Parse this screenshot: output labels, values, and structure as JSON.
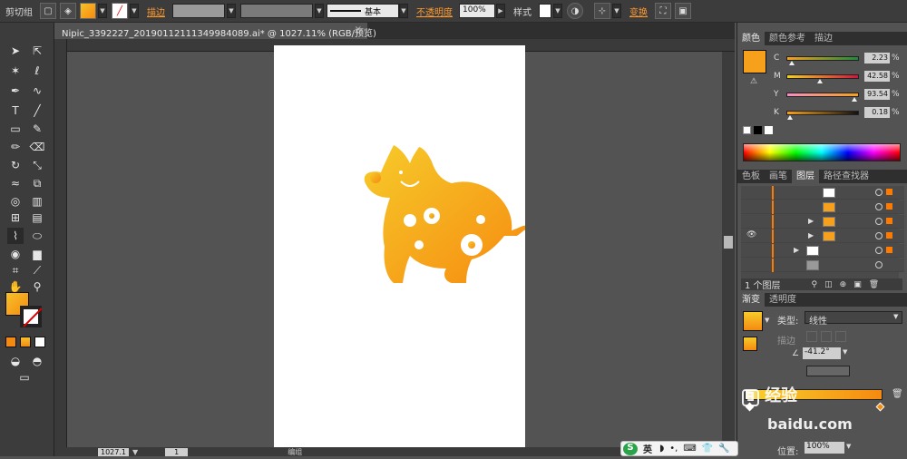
{
  "control_bar": {
    "selection_label": "剪切组",
    "stroke_label": "描边",
    "stroke_style_label": "基本",
    "opacity_label": "不透明度",
    "opacity_value": "100%",
    "style_label": "样式",
    "transform_label": "变换"
  },
  "document_tab": {
    "title": "Nipic_3392227_20190112111349984089.ai* @ 1027.11% (RGB/预览)",
    "close_glyph": "×"
  },
  "color_panel": {
    "tabs": [
      "颜色",
      "颜色参考",
      "描边"
    ],
    "channels": [
      {
        "label": "C",
        "value": "2.23",
        "unit": "%",
        "pos": 0.02
      },
      {
        "label": "M",
        "value": "42.58",
        "unit": "%",
        "pos": 0.43
      },
      {
        "label": "Y",
        "value": "93.54",
        "unit": "%",
        "pos": 0.94
      },
      {
        "label": "K",
        "value": "0.18",
        "unit": "%",
        "pos": 0.0
      }
    ],
    "fill_color": "#f7a01c"
  },
  "layers_panel": {
    "tabs": [
      "色板",
      "画笔",
      "图层",
      "路径查找器"
    ],
    "rows_count_label": "1 个图层",
    "accent_color": "#ff7b00"
  },
  "gradient_panel": {
    "tabs": [
      "渐变",
      "透明度"
    ],
    "type_label": "类型:",
    "type_value": "线性",
    "stroke_label": "描边",
    "angle_value": "-41.2°",
    "location_label": "位置:",
    "location_value": "100%"
  },
  "status_bar": {
    "zoom_value": "1027.1",
    "page_value": "1",
    "tool_label": "编组"
  },
  "watermark": {
    "text1": "经验",
    "text2": "baidu.com"
  },
  "ime": {
    "lang": "英"
  },
  "artwork": {
    "gradient_start": "#f5c022",
    "gradient_end": "#f58a10"
  }
}
